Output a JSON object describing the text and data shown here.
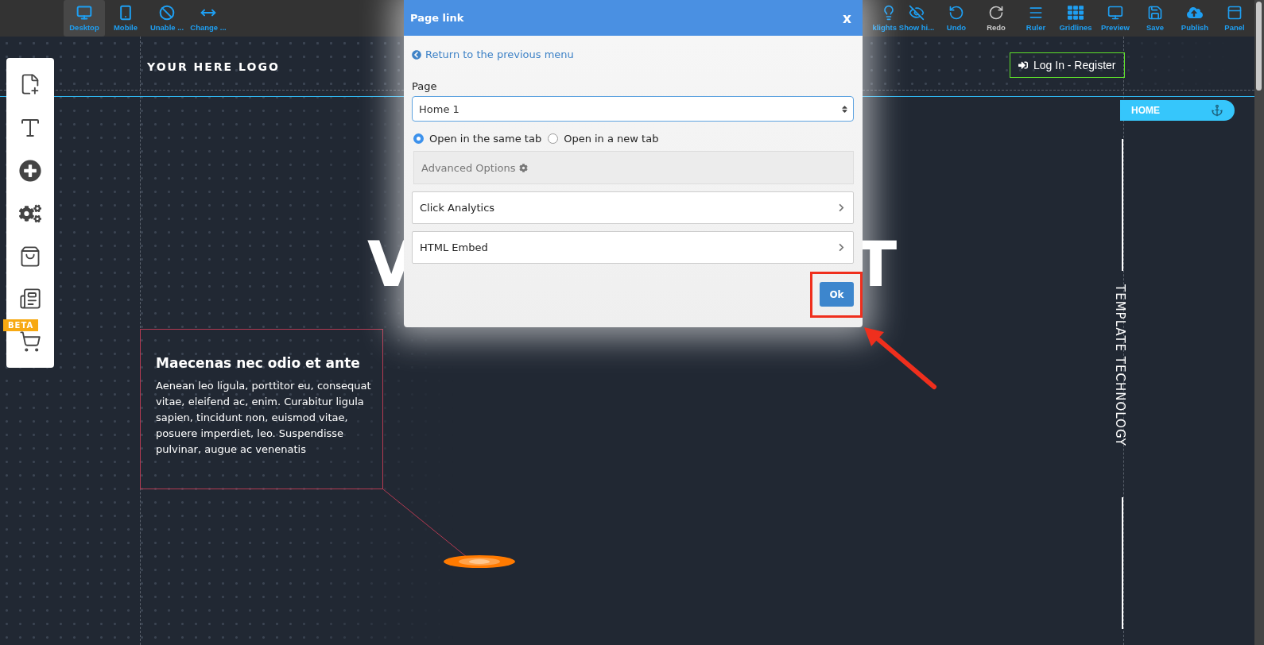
{
  "toolbar": {
    "left": [
      {
        "label": "Desktop",
        "selected": true
      },
      {
        "label": "Mobile",
        "selected": false
      },
      {
        "label": "Unable ...",
        "selected": false
      },
      {
        "label": "Change ...",
        "selected": false
      }
    ],
    "right": [
      {
        "label": "klights",
        "disabled": false
      },
      {
        "label": "Show hi...",
        "disabled": false
      },
      {
        "label": "Undo",
        "disabled": false
      },
      {
        "label": "Redo",
        "disabled": true
      },
      {
        "label": "Ruler",
        "disabled": false
      },
      {
        "label": "Gridlines",
        "disabled": false
      },
      {
        "label": "Preview",
        "disabled": false
      },
      {
        "label": "Save",
        "disabled": false
      },
      {
        "label": "Publish",
        "disabled": false
      },
      {
        "label": "Panel",
        "disabled": false
      }
    ]
  },
  "sidebar": {
    "badge": "BETA"
  },
  "canvas": {
    "logo": "YOUR HERE LOGO",
    "login": "Log In - Register",
    "nav": "HOME",
    "hero_title_fragments": [
      "V",
      "T"
    ],
    "text_box": {
      "title": "Maecenas nec odio et ante",
      "body": "Aenean leo ligula, porttitor eu, consequat vitae, eleifend ac, enim. Curabitur ligula sapien, tincidunt non, euismod vitae, posuere imperdiet, leo. Suspendisse pulvinar, augue ac venenatis"
    },
    "side_text": "TEMPLATE TECHNOLOGY"
  },
  "dialog": {
    "title": "Page link",
    "close": "x",
    "back_link": "Return to the previous menu",
    "page_label": "Page",
    "page_select": "Home 1",
    "open_options": [
      {
        "label": "Open in the same tab",
        "selected": true
      },
      {
        "label": "Open in a new tab",
        "selected": false
      }
    ],
    "advanced": "Advanced Options",
    "sections": [
      {
        "label": "Click Analytics"
      },
      {
        "label": "HTML Embed"
      }
    ],
    "ok": "Ok"
  }
}
